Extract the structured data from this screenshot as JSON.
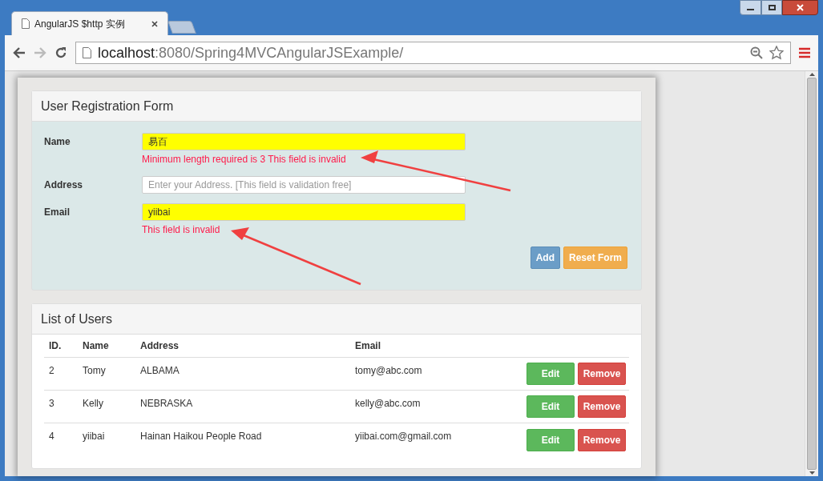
{
  "browser": {
    "tab_title": "AngularJS $http 实例",
    "url_host": "localhost",
    "url_path": ":8080/Spring4MVCAngularJSExample/"
  },
  "form": {
    "title": "User Registration Form",
    "fields": [
      {
        "label": "Name",
        "value": "易百",
        "invalid": true,
        "error": "Minimum length required is 3 This field is invalid"
      },
      {
        "label": "Address",
        "placeholder": "Enter your Address. [This field is validation free]",
        "invalid": false
      },
      {
        "label": "Email",
        "value": "yiibai",
        "invalid": true,
        "error": "This field is invalid"
      }
    ],
    "buttons": [
      {
        "label": "Add",
        "kind": "primary"
      },
      {
        "label": "Reset Form",
        "kind": "warning"
      }
    ]
  },
  "users": {
    "title": "List of Users",
    "columns": [
      "ID.",
      "Name",
      "Address",
      "Email"
    ],
    "rows": [
      {
        "id": "2",
        "name": "Tomy",
        "address": "ALBAMA",
        "email": "tomy@abc.com",
        "edit": "Edit",
        "remove": "Remove"
      },
      {
        "id": "3",
        "name": "Kelly",
        "address": "NEBRASKA",
        "email": "kelly@abc.com",
        "edit": "Edit",
        "remove": "Remove"
      },
      {
        "id": "4",
        "name": "yiibai",
        "address": "Hainan Haikou People Road",
        "email": "yiibai.com@gmail.com",
        "edit": "Edit",
        "remove": "Remove"
      }
    ]
  }
}
